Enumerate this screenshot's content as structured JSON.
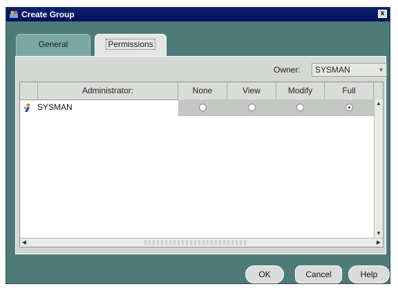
{
  "window": {
    "title": "Create Group",
    "close_label": "x"
  },
  "tabs": [
    {
      "label": "General",
      "active": false
    },
    {
      "label": "Permissions",
      "active": true
    }
  ],
  "owner": {
    "label": "Owner:",
    "value": "SYSMAN"
  },
  "table": {
    "columns": [
      "Administrator:",
      "None",
      "View",
      "Modify",
      "Full"
    ],
    "rows": [
      {
        "name": "SYSMAN",
        "permission": "Full"
      }
    ]
  },
  "buttons": {
    "ok": "OK",
    "cancel": "Cancel",
    "help": "Help"
  },
  "icons": {
    "title": "group-window-icon",
    "row": "administrator-icon"
  },
  "colors": {
    "titlebar": "#001060",
    "window": "#4e7b78",
    "panel": "#d4d7d3"
  }
}
